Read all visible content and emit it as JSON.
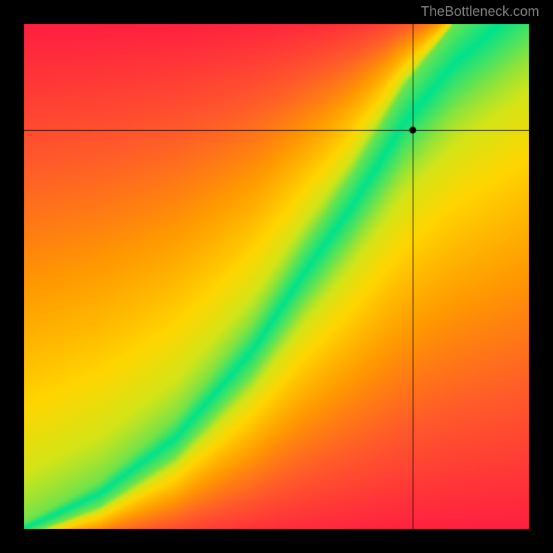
{
  "watermark": "TheBottleneck.com",
  "chart_data": {
    "type": "heatmap",
    "title": "",
    "xlabel": "",
    "ylabel": "",
    "xlim": [
      0,
      1
    ],
    "ylim": [
      0,
      1
    ],
    "crosshair": {
      "x": 0.77,
      "y": 0.79
    },
    "marker": {
      "x": 0.77,
      "y": 0.79
    },
    "ideal_curve": {
      "description": "green ridge of optimal balance; y as a function of x",
      "control_points": [
        {
          "x": 0.0,
          "y": 0.0
        },
        {
          "x": 0.15,
          "y": 0.07
        },
        {
          "x": 0.3,
          "y": 0.18
        },
        {
          "x": 0.45,
          "y": 0.35
        },
        {
          "x": 0.55,
          "y": 0.5
        },
        {
          "x": 0.65,
          "y": 0.64
        },
        {
          "x": 0.75,
          "y": 0.8
        },
        {
          "x": 0.85,
          "y": 0.92
        },
        {
          "x": 1.0,
          "y": 1.05
        }
      ]
    },
    "color_stops": [
      {
        "t": 0.0,
        "color": "#00e28a"
      },
      {
        "t": 0.1,
        "color": "#6ee34b"
      },
      {
        "t": 0.22,
        "color": "#d3e417"
      },
      {
        "t": 0.35,
        "color": "#ffd500"
      },
      {
        "t": 0.55,
        "color": "#ff9a00"
      },
      {
        "t": 0.75,
        "color": "#ff5a2a"
      },
      {
        "t": 1.0,
        "color": "#ff1444"
      }
    ],
    "band_halfwidth": 0.055,
    "pixelation": 3
  }
}
